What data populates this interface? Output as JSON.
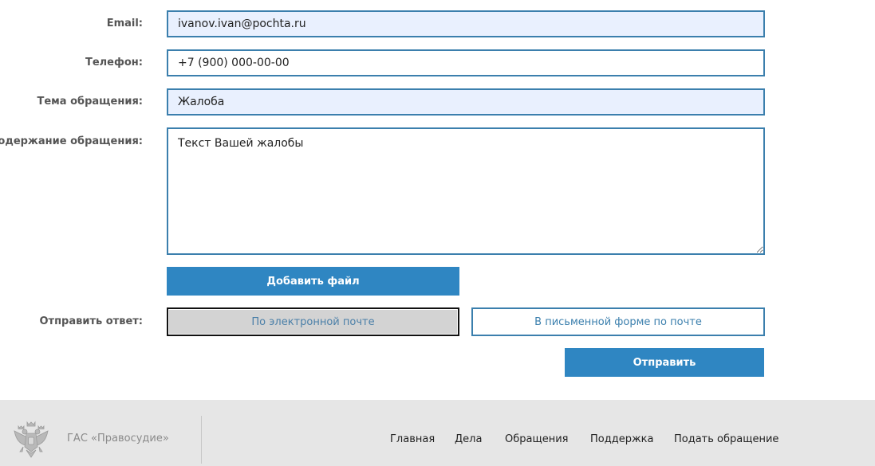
{
  "form": {
    "email": {
      "label": "Email:",
      "value": "ivanov.ivan@pochta.ru"
    },
    "phone": {
      "label": "Телефон:",
      "value": "+7 (900) 000-00-00"
    },
    "subject": {
      "label": "Тема обращения:",
      "value": "Жалоба"
    },
    "content": {
      "label": "Содержание обращения:",
      "value": "Текст Вашей жалобы"
    },
    "add_file_label": "Добавить файл",
    "reply": {
      "label": "Отправить ответ:",
      "options": [
        "По электронной почте",
        "В письменной форме по почте"
      ],
      "selected": "По электронной почте"
    },
    "submit_label": "Отправить"
  },
  "footer": {
    "brand": "ГАС «Правосудие»",
    "emblem_icon": "coat-of-arms-icon",
    "nav": [
      "Главная",
      "Дела",
      "Обращения",
      "Поддержка",
      "Подать обращение"
    ]
  },
  "colors": {
    "accent": "#2f86c2",
    "field_border": "#3b7fad",
    "filled_bg": "#e9f0fe",
    "footer_bg": "#e6e6e6"
  }
}
